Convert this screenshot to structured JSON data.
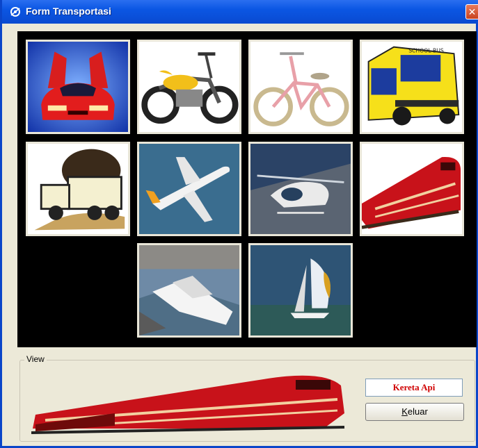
{
  "window": {
    "title": "Form Transportasi",
    "close_glyph": "✕"
  },
  "gallery": {
    "items": [
      {
        "name": "red-sports-car",
        "icon": "sports-car-image"
      },
      {
        "name": "yellow-motorcycle",
        "icon": "motorcycle-image"
      },
      {
        "name": "pink-bicycle",
        "icon": "bicycle-image"
      },
      {
        "name": "yellow-bus",
        "icon": "bus-image"
      },
      {
        "name": "dump-truck",
        "icon": "truck-image"
      },
      {
        "name": "airplane",
        "icon": "airplane-image"
      },
      {
        "name": "helicopter",
        "icon": "helicopter-image"
      },
      {
        "name": "red-train",
        "icon": "train-image"
      },
      {
        "name": "cruise-ship",
        "icon": "ship-image"
      },
      {
        "name": "sailboat",
        "icon": "sailboat-image"
      }
    ],
    "bus_sign": "SCHOOL BUS"
  },
  "view": {
    "legend": "View",
    "selected_name": "Kereta Api",
    "exit_label_first": "K",
    "exit_label_rest": "eluar"
  },
  "colors": {
    "titlebar": "#0b56e3",
    "selected_text": "#d00000",
    "panel_bg": "#000000"
  }
}
